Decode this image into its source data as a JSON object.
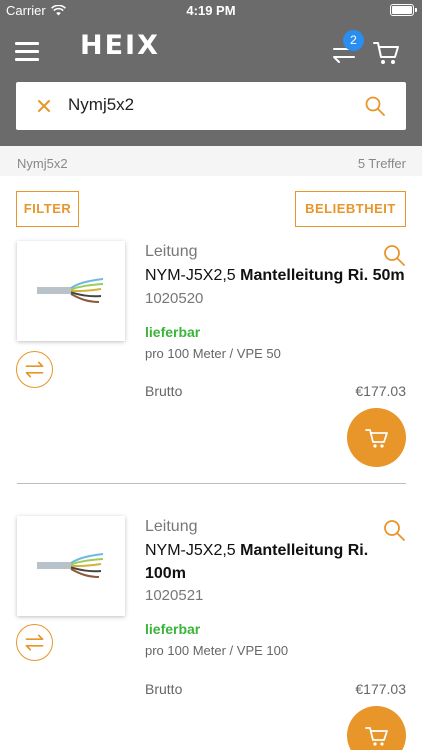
{
  "status_bar": {
    "carrier": "Carrier",
    "time": "4:19 PM"
  },
  "header": {
    "logo": "HEIX",
    "compare_count": "2"
  },
  "search": {
    "query": "Nymj5x2"
  },
  "results": {
    "term": "Nymj5x2",
    "count": "5 Treffer"
  },
  "toolbar": {
    "filter_label": "FILTER",
    "sort_label": "BELIEBTHEIT"
  },
  "products": [
    {
      "category": "Leitung",
      "code": "NYM-J5X2,5",
      "name": "Mantelleitung Ri. 50m",
      "sku": "1020520",
      "availability": "lieferbar",
      "unit": "pro 100 Meter  / VPE 50",
      "price_label": "Brutto",
      "price": "€177.03"
    },
    {
      "category": "Leitung",
      "code": "NYM-J5X2,5",
      "name": "Mantelleitung Ri. 100m",
      "sku": "1020521",
      "availability": "lieferbar",
      "unit": "pro 100 Meter  / VPE 100",
      "price_label": "Brutto",
      "price": "€177.03"
    }
  ],
  "colors": {
    "accent": "#e8952a",
    "header": "#6b6b6b",
    "available": "#3ab53a",
    "badge": "#2a8ef0"
  }
}
